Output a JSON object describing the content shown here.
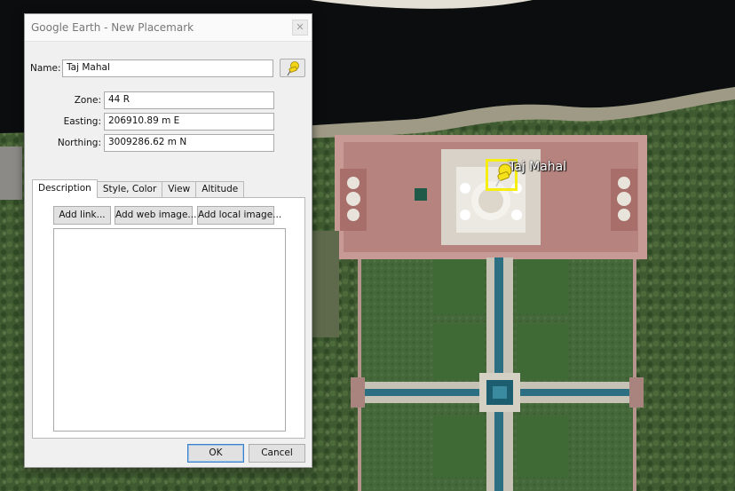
{
  "window": {
    "title": "Google Earth - New Placemark",
    "close_glyph": "✕"
  },
  "placemark": {
    "name_label": "Name:",
    "name_value": "Taj Mahal",
    "pin_icon": "yellow-pushpin-icon",
    "zone_label": "Zone:",
    "zone_value": "44 R",
    "easting_label": "Easting:",
    "easting_value": "206910.89 m E",
    "northing_label": "Northing:",
    "northing_value": "3009286.62 m N"
  },
  "tabs": [
    {
      "label": "Description",
      "active": true
    },
    {
      "label": "Style, Color",
      "active": false
    },
    {
      "label": "View",
      "active": false
    },
    {
      "label": "Altitude",
      "active": false
    }
  ],
  "description": {
    "add_link": "Add link...",
    "add_web_image": "Add web image...",
    "add_local_image": "Add local image...",
    "text": ""
  },
  "footer": {
    "ok": "OK",
    "cancel": "Cancel"
  },
  "map": {
    "placemark_label": "Taj Mahal",
    "highlight_color": "#f5ee10"
  }
}
